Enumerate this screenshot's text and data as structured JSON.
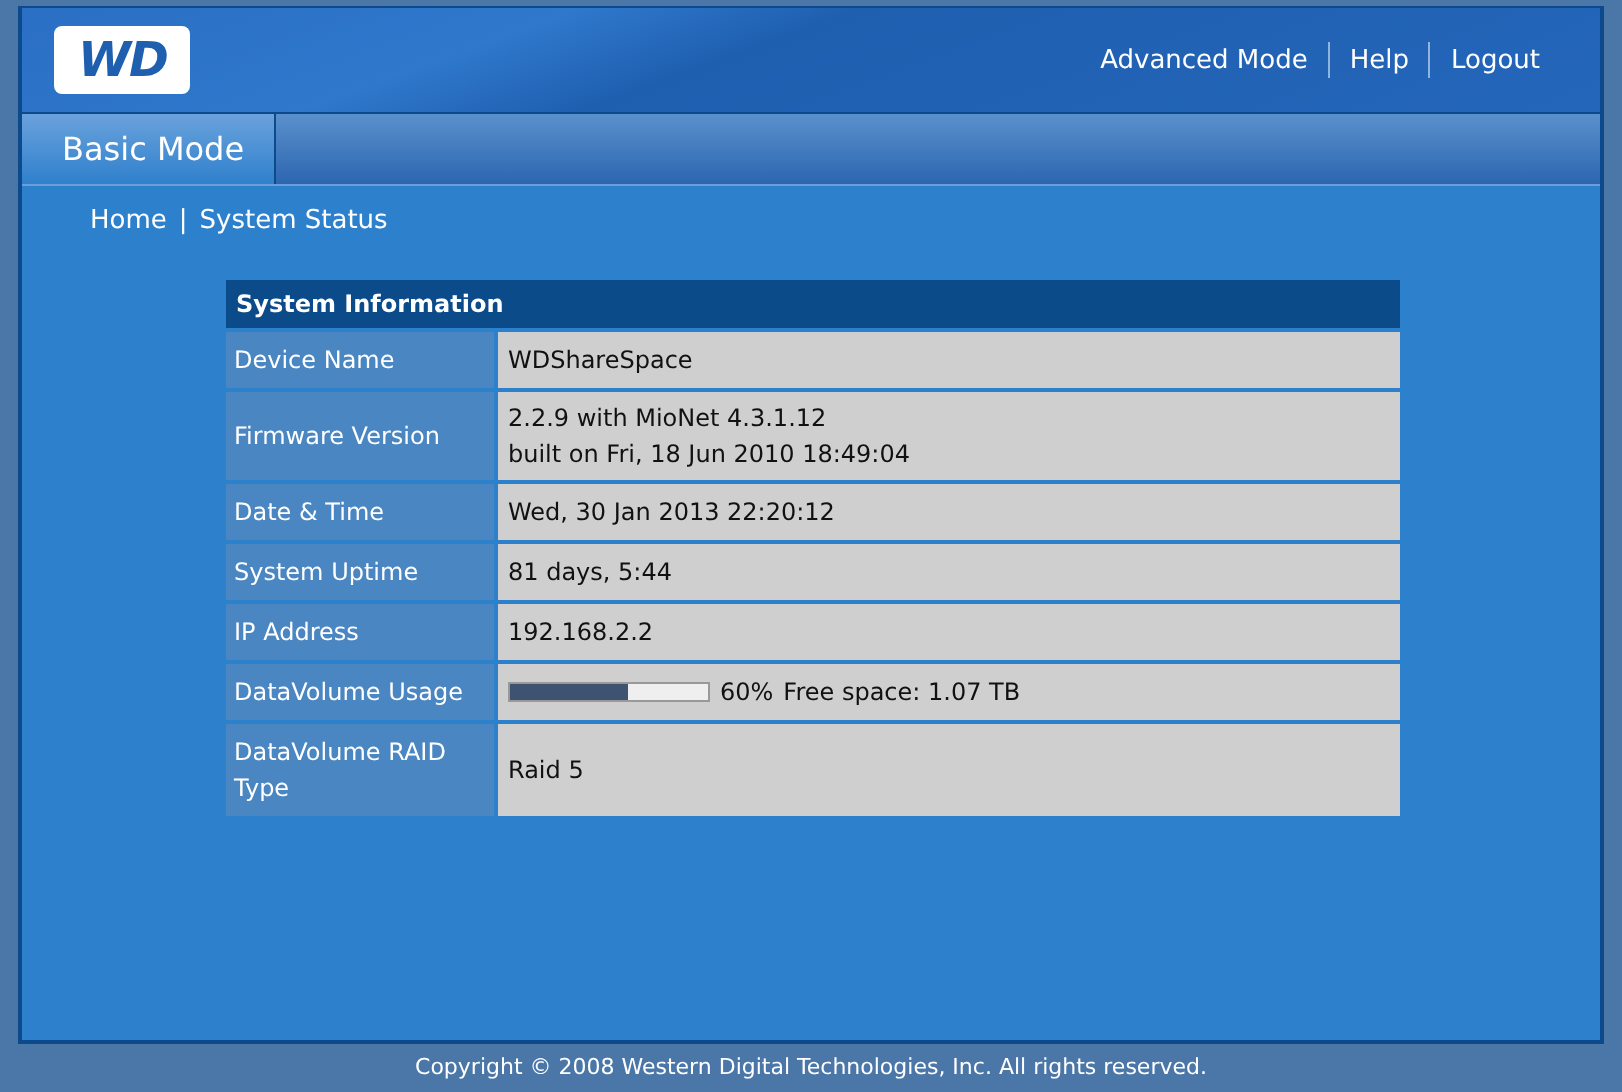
{
  "header": {
    "logo": "WD",
    "links": [
      {
        "label": "Advanced Mode"
      },
      {
        "label": "Help"
      },
      {
        "label": "Logout"
      }
    ]
  },
  "tabs": [
    {
      "label": "Basic Mode",
      "selected": true
    }
  ],
  "breadcrumb": {
    "items": [
      "Home",
      "System Status"
    ],
    "separator": "|"
  },
  "table": {
    "title": "System Information",
    "rows": [
      {
        "kind": "text",
        "label": "Device Name",
        "lines": [
          "WDShareSpace"
        ]
      },
      {
        "kind": "text",
        "label": "Firmware Version",
        "lines": [
          "2.2.9 with MioNet 4.3.1.12",
          "built on Fri, 18 Jun 2010 18:49:04"
        ]
      },
      {
        "kind": "text",
        "label": "Date & Time",
        "lines": [
          "Wed, 30 Jan 2013 22:20:12"
        ]
      },
      {
        "kind": "text",
        "label": "System Uptime",
        "lines": [
          "81 days, 5:44"
        ]
      },
      {
        "kind": "text",
        "label": "IP Address",
        "lines": [
          "192.168.2.2"
        ]
      },
      {
        "kind": "usage",
        "label": "DataVolume Usage",
        "level": 0.6,
        "reading": "60%",
        "free": "Free space: 1.07 TB"
      },
      {
        "kind": "text",
        "label": "DataVolume RAID Type",
        "lines": [
          "Raid 5"
        ]
      }
    ]
  },
  "footer": "Copyright © 2008 Western Digital Technologies, Inc. All rights reserved."
}
